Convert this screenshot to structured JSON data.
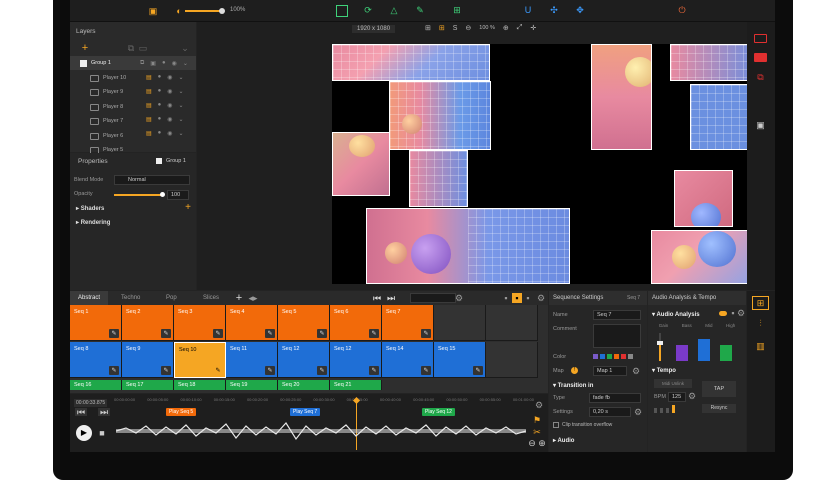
{
  "toolbar": {
    "zoom_value": "100%",
    "resolution": "1920 x 1080",
    "canvas_zoom": "100 %",
    "canvas_s": "S"
  },
  "layers": {
    "title": "Layers",
    "items": [
      {
        "label": "Group 1"
      },
      {
        "label": "Player 10"
      },
      {
        "label": "Player 9"
      },
      {
        "label": "Player 8"
      },
      {
        "label": "Player 7"
      },
      {
        "label": "Player 6"
      },
      {
        "label": "Player 5"
      }
    ]
  },
  "properties": {
    "title": "Properties",
    "target": "Group 1",
    "blend_label": "Blend Mode",
    "blend_value": "Normal",
    "opacity_label": "Opacity",
    "opacity_value": "100",
    "shaders": "Shaders",
    "rendering": "Rendering"
  },
  "seq_tabs": [
    "Abstract",
    "Techno",
    "Pop",
    "Slices"
  ],
  "sequences_row1": [
    "Seq 1",
    "Seq 2",
    "Seq 3",
    "Seq 4",
    "Seq 5",
    "Seq 6",
    "Seq 7"
  ],
  "sequences_row2": [
    "Seq 8",
    "Seq 9",
    "Seq 10",
    "Seq 11",
    "Seq 12",
    "Seq 12",
    "Seq 14",
    "Seq 15"
  ],
  "sequences_row3": [
    "Seq 16",
    "Seq 17",
    "Seq 18",
    "Seq 19",
    "Seq 20",
    "Seq 21"
  ],
  "seq_settings": {
    "title": "Sequence Settings",
    "seq": "Seq 7",
    "name_label": "Name",
    "name_value": "Seq 7",
    "comment_label": "Comment",
    "color_label": "Color",
    "map_label": "Map",
    "map_value": "Map 1",
    "transition_in": "Transition in",
    "type_label": "Type",
    "type_value": "fade fb",
    "settings_label": "Settings",
    "settings_value": "0,20 s",
    "clip_overflow": "Clip transition overflow",
    "audio": "Audio"
  },
  "audio_panel": {
    "title": "Audio Analysis & Tempo",
    "analysis": "Audio Analysis",
    "bands": [
      "Gain",
      "Bass",
      "Mid",
      "High"
    ],
    "tempo": "Tempo",
    "midi": "Midi Unlink",
    "tap": "TAP",
    "bpm_label": "BPM",
    "bpm_value": "125",
    "resync": "Resync"
  },
  "timeline": {
    "time": "00:00:33.875",
    "ticks": [
      "00:00:00:00",
      "00:00:05:00",
      "00:00:10:00",
      "00:00:15:00",
      "00:00:20:00",
      "00:00:25:00",
      "00:00:30:00",
      "00:00:35:00",
      "00:00:40:00",
      "00:00:45:00",
      "00:00:50:00",
      "00:00:55:00",
      "00:01:00:00"
    ],
    "markers": [
      "Play Seq 5",
      "Play Seq 7",
      "Play Seq 12"
    ]
  },
  "colors": {
    "orange": "#f26a0a",
    "blue": "#1f6fd6",
    "green": "#1fa84a",
    "selected": "#f5a623",
    "accent": "#3fd27a"
  }
}
